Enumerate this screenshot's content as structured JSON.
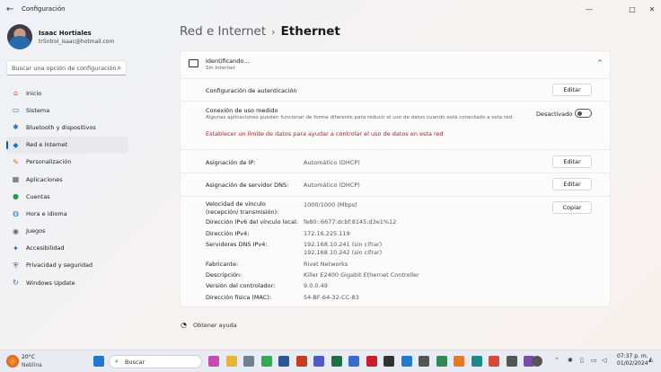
{
  "window": {
    "title": "Configuración",
    "back": "←",
    "minimize": "—",
    "maximize": "□",
    "close": "✕"
  },
  "user": {
    "name": "Isaac Hortiales",
    "email": "tr5ntrol_isaac@hotmail.com"
  },
  "search": {
    "placeholder": "Buscar una opción de configuración"
  },
  "nav": [
    {
      "label": "Inicio",
      "icon": "home-icon",
      "glyph": "⌂",
      "color": "#d24a36"
    },
    {
      "label": "Sistema",
      "icon": "system-icon",
      "glyph": "▭",
      "color": "#1a73c8"
    },
    {
      "label": "Bluetooth y dispositivos",
      "icon": "bluetooth-icon",
      "glyph": "✱",
      "color": "#1a73c8"
    },
    {
      "label": "Red e Internet",
      "icon": "network-icon",
      "glyph": "◆",
      "color": "#1a73c8"
    },
    {
      "label": "Personalización",
      "icon": "brush-icon",
      "glyph": "✎",
      "color": "#d2691e"
    },
    {
      "label": "Aplicaciones",
      "icon": "apps-icon",
      "glyph": "▦",
      "color": "#555"
    },
    {
      "label": "Cuentas",
      "icon": "accounts-icon",
      "glyph": "●",
      "color": "#2e9a4b"
    },
    {
      "label": "Hora e idioma",
      "icon": "time-language-icon",
      "glyph": "◍",
      "color": "#1a73c8"
    },
    {
      "label": "Juegos",
      "icon": "gaming-icon",
      "glyph": "◉",
      "color": "#666"
    },
    {
      "label": "Accesibilidad",
      "icon": "accessibility-icon",
      "glyph": "✦",
      "color": "#1a5fb4"
    },
    {
      "label": "Privacidad y seguridad",
      "icon": "shield-icon",
      "glyph": "⛨",
      "color": "#666"
    },
    {
      "label": "Windows Update",
      "icon": "update-icon",
      "glyph": "↻",
      "color": "#1a73c8"
    }
  ],
  "breadcrumb": {
    "parent": "Red e Internet",
    "sep": "›",
    "current": "Ethernet"
  },
  "connection": {
    "status": "Identificando...",
    "sub": "Sin Internet",
    "chevron": "^"
  },
  "auth": {
    "label": "Configuración de autenticación",
    "button": "Editar"
  },
  "metered": {
    "label": "Conexión de uso medido",
    "desc": "Algunas aplicaciones pueden funcionar de forma diferente para reducir el uso de datos cuando está conectado a esta red.",
    "state": "Desactivado",
    "link": "Establecer un límite de datos para ayudar a controlar el uso de datos en esta red"
  },
  "ip": {
    "label": "Asignación de IP:",
    "value": "Automático (DHCP)",
    "button": "Editar"
  },
  "dns": {
    "label": "Asignación de servidor DNS:",
    "value": "Automático (DHCP)",
    "button": "Editar"
  },
  "props": [
    {
      "label": "Velocidad de vínculo (recepción/ transmisión):",
      "value": "1000/1000 (Mbps)"
    },
    {
      "label": "Dirección IPv6 del vínculo local:",
      "value": "fe80::6677:dcbf:8145:d3e1%12"
    },
    {
      "label": "Dirección IPv4:",
      "value": "172.16.225.119"
    },
    {
      "label": "Servidores DNS IPv4:",
      "value": "192.168.10.241 (sin cifrar)",
      "value2": "192.168.10.242 (sin cifrar)"
    },
    {
      "label": "Fabricante:",
      "value": "Rivet Networks"
    },
    {
      "label": "Descripción:",
      "value": "Killer E2400 Gigabit Ethernet Controller"
    },
    {
      "label": "Versión del controlador:",
      "value": "9.0.0.49"
    },
    {
      "label": "Dirección física (MAC):",
      "value": "54-BF-64-32-CC-83"
    }
  ],
  "copy_button": "Copiar",
  "help": "Obtener ayuda",
  "taskbar": {
    "temp": "20°C",
    "weather": "Neblina",
    "search": "Buscar",
    "time": "07:37 p. m.",
    "date": "01/02/2024",
    "apps": [
      {
        "name": "start-icon",
        "color": "#1f78d1"
      },
      {
        "name": "copilot-icon",
        "color": "#c84ab0"
      },
      {
        "name": "file-explorer-icon",
        "color": "#e8b43a"
      },
      {
        "name": "photos-icon",
        "color": "#6e7f8f"
      },
      {
        "name": "chrome-icon",
        "color": "#34a853"
      },
      {
        "name": "word-icon",
        "color": "#2b579a"
      },
      {
        "name": "powerpoint-icon",
        "color": "#c43e1c"
      },
      {
        "name": "teams-icon",
        "color": "#5059c9"
      },
      {
        "name": "excel-icon",
        "color": "#1d7044"
      },
      {
        "name": "mail-icon",
        "color": "#3a6bc8"
      },
      {
        "name": "pdf-icon",
        "color": "#c8202a"
      },
      {
        "name": "terminal-icon",
        "color": "#333"
      },
      {
        "name": "vscode-icon",
        "color": "#1e7cc8"
      },
      {
        "name": "media-icon",
        "color": "#555"
      },
      {
        "name": "app-green-icon",
        "color": "#2e8b57"
      },
      {
        "name": "app-orange-icon",
        "color": "#e07b22"
      },
      {
        "name": "app-teal-icon",
        "color": "#1a8a8a"
      },
      {
        "name": "app-red-icon",
        "color": "#d24a36"
      },
      {
        "name": "app-gray-icon",
        "color": "#555"
      },
      {
        "name": "app-purple-icon",
        "color": "#7a4ab0"
      },
      {
        "name": "app-dark-icon",
        "color": "#333"
      },
      {
        "name": "settings-icon",
        "color": "#555"
      }
    ]
  }
}
